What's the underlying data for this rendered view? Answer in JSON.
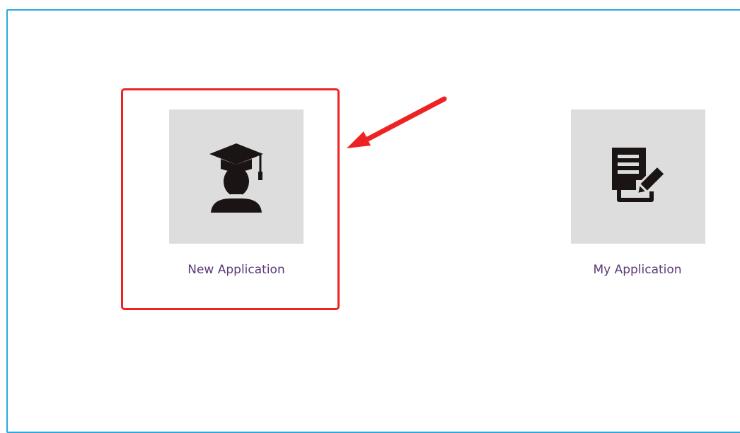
{
  "tiles": [
    {
      "id": "new-application",
      "label": "New Application",
      "icon": "graduate-icon"
    },
    {
      "id": "my-application",
      "label": "My Application",
      "icon": "document-edit-icon"
    }
  ],
  "colors": {
    "frame_border": "#29a9e1",
    "tile_background": "#dddddd",
    "label_text": "#5b3a78",
    "icon_fill": "#1a1414",
    "annotation_red": "#ee2222"
  }
}
